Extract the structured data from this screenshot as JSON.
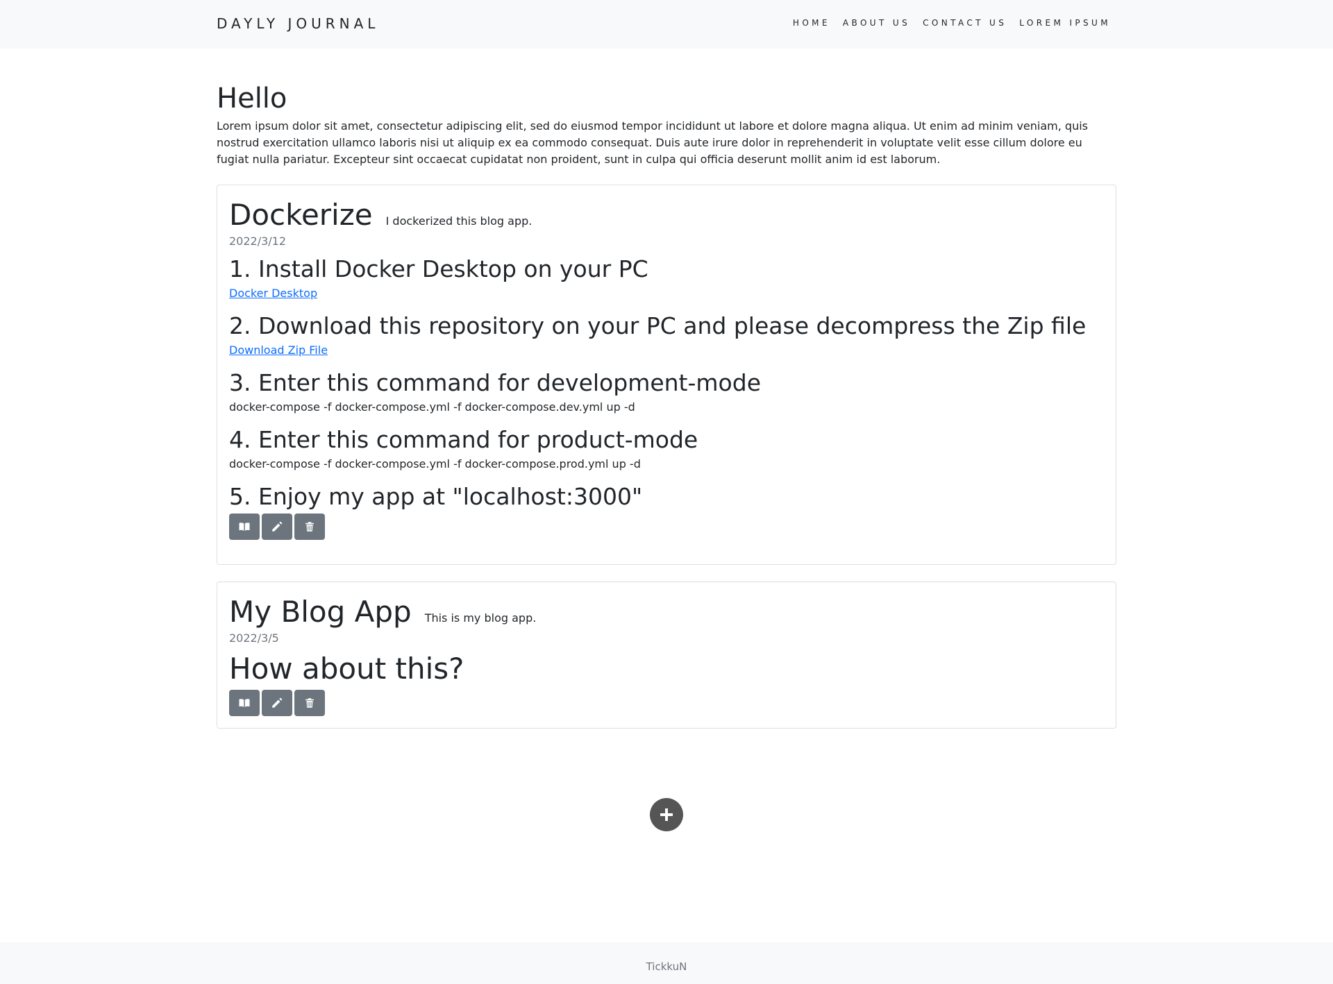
{
  "nav": {
    "brand": "DAYLY JOURNAL",
    "links": [
      "HOME",
      "ABOUT US",
      "CONTACT US",
      "LOREM IPSUM"
    ]
  },
  "intro": {
    "heading": "Hello",
    "text": "Lorem ipsum dolor sit amet, consectetur adipiscing elit, sed do eiusmod tempor incididunt ut labore et dolore magna aliqua. Ut enim ad minim veniam, quis nostrud exercitation ullamco laboris nisi ut aliquip ex ea commodo consequat. Duis aute irure dolor in reprehenderit in voluptate velit esse cillum dolore eu fugiat nulla pariatur. Excepteur sint occaecat cupidatat non proident, sunt in culpa qui officia deserunt mollit anim id est laborum."
  },
  "posts": [
    {
      "title": "Dockerize",
      "subtitle": "I dockerized this blog app.",
      "date": "2022/3/12",
      "step1": "1. Install Docker Desktop on your PC",
      "link1": "Docker Desktop",
      "step2": "2. Download this repository on your PC and please decompress the Zip file",
      "link2": "Download Zip File",
      "step3": "3. Enter this command for development-mode",
      "cmd3": "docker-compose -f docker-compose.yml -f docker-compose.dev.yml up -d",
      "step4": "4. Enter this command for product-mode",
      "cmd4": "docker-compose -f docker-compose.yml -f docker-compose.prod.yml up -d",
      "step5": "5. Enjoy my app at \"localhost:3000\""
    },
    {
      "title": "My Blog App",
      "subtitle": "This is my blog app.",
      "date": "2022/3/5",
      "body": "How about this?"
    }
  ],
  "actions": {
    "icons": [
      "book-icon",
      "pencil-icon",
      "trash-icon"
    ],
    "color": "#6c757d"
  },
  "add": {
    "icon": "plus-icon",
    "color": "#555555"
  },
  "footer": {
    "text": "TickkuN"
  }
}
